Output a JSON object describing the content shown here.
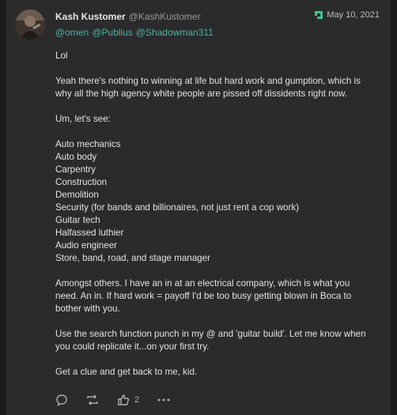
{
  "post": {
    "display_name": "Kash Kustomer",
    "handle": "@KashKustomer",
    "date": "May 10, 2021",
    "mentions": [
      "@omen",
      "@Publius",
      "@Shadowman311"
    ],
    "paragraphs": [
      [
        "Lol"
      ],
      [
        "Yeah there's nothing to winning at life but hard work and gumption, which is",
        "why all the high agency white people are pissed off dissidents right now."
      ],
      [
        "Um, let's see:"
      ],
      [
        "Auto mechanics",
        "Auto body",
        "Carpentry",
        "Construction",
        "Demolition",
        "Security (for bands and billionaires, not just rent a cop work)",
        "Guitar tech",
        "Halfassed luthier",
        "Audio engineer",
        "Store, band, road, and stage manager"
      ],
      [
        "Amongst others. I have an in at an electrical company, which is what you",
        "need. An in. If hard work = payoff I'd be too busy getting blown in Boca to",
        "bother with you."
      ],
      [
        "Use the search function punch in my @ and 'guitar build'. Let me know when",
        "you could replicate it...on your first try."
      ],
      [
        "Get a clue and get back to me, kid."
      ]
    ]
  },
  "actions": {
    "like_count": "2"
  },
  "colors": {
    "accent": "#4fb1a8",
    "background": "#2b2b2b",
    "text": "#e3e3e3"
  },
  "icons": [
    "reply-icon",
    "repost-icon",
    "like-icon",
    "more-icon",
    "gab-logo-icon"
  ]
}
